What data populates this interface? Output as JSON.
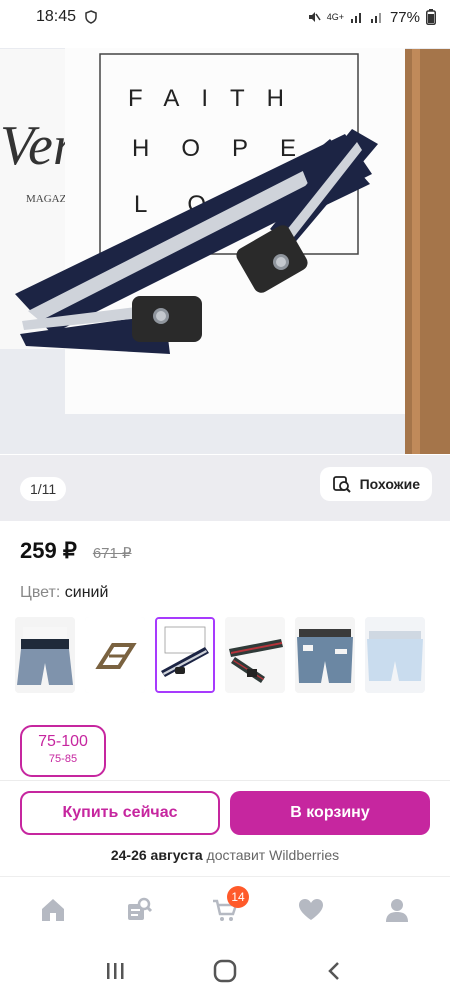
{
  "status_bar": {
    "time": "18:45",
    "battery": "77%",
    "network": "4G+"
  },
  "gallery": {
    "pager": "1/11",
    "similar_label": "Похожие"
  },
  "hero_card_text": {
    "line1": "FAITH",
    "line2": "HOPE",
    "line3": "LO",
    "magazine_word": "MAGAZIN",
    "brand_partial": "Ver"
  },
  "price": {
    "current": "259 ₽",
    "old": "671 ₽"
  },
  "color": {
    "label": "Цвет:",
    "value": "синий"
  },
  "thumbnails": [
    {
      "name": "denim-shorts"
    },
    {
      "name": "buckle"
    },
    {
      "name": "navy-belt",
      "selected": true
    },
    {
      "name": "red-belt"
    },
    {
      "name": "shorts-belt"
    },
    {
      "name": "white-shorts"
    }
  ],
  "size": {
    "primary": "75-100",
    "secondary": "75-85"
  },
  "actions": {
    "buy_now": "Купить сейчас",
    "add_to_cart": "В корзину"
  },
  "delivery": {
    "date": "24-26 августа",
    "text": "доставит Wildberries"
  },
  "tabbar": {
    "items": [
      {
        "icon": "home-icon"
      },
      {
        "icon": "catalog-search-icon"
      },
      {
        "icon": "cart-icon",
        "badge": "14"
      },
      {
        "icon": "heart-icon"
      },
      {
        "icon": "profile-icon"
      }
    ]
  },
  "colors": {
    "accent": "#c6269f",
    "badge": "#ff5a2a",
    "strap": "#1c2444"
  }
}
